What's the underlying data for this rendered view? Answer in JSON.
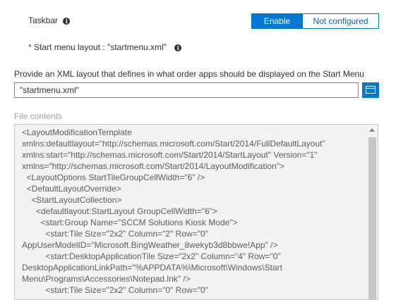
{
  "taskbar": {
    "label": "Taskbar",
    "info_glyph": "i",
    "options": [
      "Enable",
      "Not configured"
    ],
    "selected": "Enable"
  },
  "start_menu": {
    "required_mark": "*",
    "label": "Start menu layout : \"startmenu.xml\"",
    "info_glyph": "i"
  },
  "xml_layout": {
    "description": "Provide an XML layout that defines in what order apps should be displayed on the Start Menu",
    "value": "\"startmenu.xml\""
  },
  "file_contents": {
    "label": "File contents",
    "lines": [
      "<LayoutModificationTemplate",
      "xmlns:defaultlayout=\"http://schemas.microsoft.com/Start/2014/FullDefaultLayout\"",
      "xmlns:start=\"http://schemas.microsoft.com/Start/2014/StartLayout\" Version=\"1\"",
      "xmlns=\"http://schemas.microsoft.com/Start/2014/LayoutModification\">",
      "  <LayoutOptions StartTileGroupCellWidth=\"6\" />",
      "  <DefaultLayoutOverride>",
      "    <StartLayoutCollection>",
      "      <defaultlayout:StartLayout GroupCellWidth=\"6\">",
      "        <start:Group Name=\"SCCM Solutions Kiosk Mode\">",
      "          <start:Tile Size=\"2x2\" Column=\"2\" Row=\"0\"",
      "AppUserModelID=\"Microsoft.BingWeather_8wekyb3d8bbwe!App\" />",
      "          <start:DesktopApplicationTile Size=\"2x2\" Column=\"4\" Row=\"0\"",
      "DesktopApplicationLinkPath=\"%APPDATA%\\Microsoft\\Windows\\Start",
      "Menu\\Programs\\Accessories\\Notepad.lnk\" />",
      "          <start:Tile Size=\"2x2\" Column=\"0\" Row=\"0\""
    ]
  },
  "icons": {
    "info": "info-icon",
    "browse": "folder-icon",
    "scroll_up": "chevron-up-icon"
  },
  "colors": {
    "accent": "#0078d4",
    "required": "#a4262c",
    "textarea_bg": "#f3f2f1"
  }
}
